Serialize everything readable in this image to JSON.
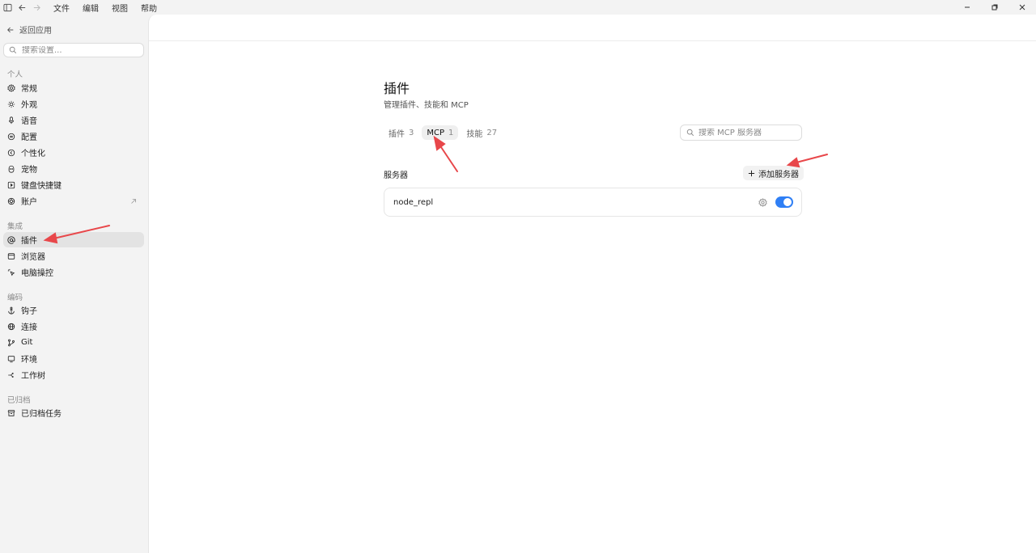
{
  "titlebar": {
    "menu": [
      "文件",
      "编辑",
      "视图",
      "帮助"
    ]
  },
  "sidebar": {
    "back_label": "返回应用",
    "search_placeholder": "搜索设置...",
    "sections": [
      {
        "label": "个人",
        "items": [
          "常规",
          "外观",
          "语音",
          "配置",
          "个性化",
          "宠物",
          "键盘快捷键",
          "账户"
        ]
      },
      {
        "label": "集成",
        "items": [
          "插件",
          "浏览器",
          "电脑操控"
        ]
      },
      {
        "label": "编码",
        "items": [
          "钩子",
          "连接",
          "Git",
          "环境",
          "工作树"
        ]
      },
      {
        "label": "已归档",
        "items": [
          "已归档任务"
        ]
      }
    ],
    "active_item": "插件"
  },
  "main": {
    "title": "插件",
    "subtitle": "管理插件、技能和 MCP",
    "tabs": [
      {
        "label": "插件",
        "count": "3"
      },
      {
        "label": "MCP",
        "count": "1"
      },
      {
        "label": "技能",
        "count": "27"
      }
    ],
    "active_tab": "MCP",
    "search_placeholder": "搜索 MCP 服务器",
    "servers_heading": "服务器",
    "add_server_label": "添加服务器",
    "servers": [
      {
        "name": "node_repl",
        "enabled": true
      }
    ]
  },
  "colors": {
    "accent": "#2f7ff5",
    "annotation_arrow": "#e8474a"
  }
}
